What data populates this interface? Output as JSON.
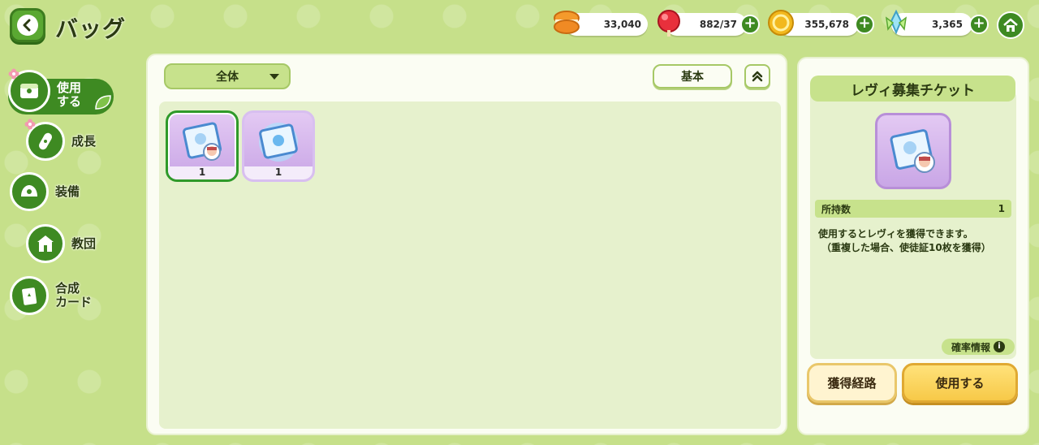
{
  "header": {
    "title": "バッグ"
  },
  "resources": [
    {
      "name": "macaron",
      "icon": "macaron-icon",
      "value": "33,040",
      "color": "#f08a24"
    },
    {
      "name": "candy",
      "icon": "candy-icon",
      "value": "882/37",
      "color": "#e8303c"
    },
    {
      "name": "coin",
      "icon": "coin-icon",
      "value": "355,678",
      "color": "#f2b81e"
    },
    {
      "name": "crystal",
      "icon": "crystal-icon",
      "value": "3,365",
      "color": "#7fd6f0"
    }
  ],
  "sidebar": {
    "items": [
      {
        "label_line1": "使用",
        "label_line2": "する",
        "icon": "chest-icon",
        "active": true,
        "has_new": true
      },
      {
        "label_line1": "成長",
        "label_line2": "",
        "icon": "bandage-icon",
        "active": false,
        "has_new": true
      },
      {
        "label_line1": "装備",
        "label_line2": "",
        "icon": "equipment-icon",
        "active": false,
        "has_new": false
      },
      {
        "label_line1": "教団",
        "label_line2": "",
        "icon": "temple-icon",
        "active": false,
        "has_new": false
      },
      {
        "label_line1": "合成",
        "label_line2": "カード",
        "icon": "card-icon",
        "active": false,
        "has_new": false
      }
    ]
  },
  "toolbar": {
    "filter_label": "全体",
    "sort_label": "基本"
  },
  "items": [
    {
      "name": "レヴィ募集チケット",
      "quantity": "1",
      "selected": true
    },
    {
      "name": "recruit-ticket-blue",
      "quantity": "1",
      "selected": false
    }
  ],
  "detail": {
    "title": "レヴィ募集チケット",
    "owned_label": "所持数",
    "owned_value": "1",
    "description_line1": "使用するとレヴィを獲得できます。",
    "description_line2": "（重複した場合、使徒証10枚を獲得）",
    "rate_info_label": "確率情報",
    "route_button": "獲得経路",
    "use_button": "使用する"
  },
  "colors": {
    "background": "#c6e08a",
    "accent_green": "#3e8a22",
    "panel": "#fbfdf3",
    "item_purple": "#c9a6e6",
    "use_button": "#f7c948"
  }
}
